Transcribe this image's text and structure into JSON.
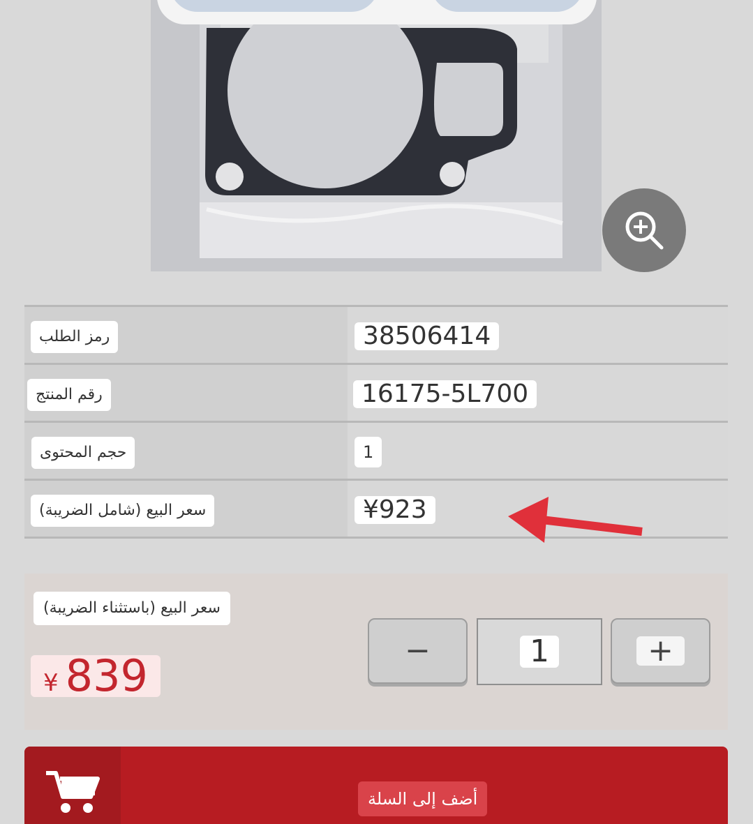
{
  "product": {
    "image_alt": "gasket",
    "zoom_icon": "zoom-in-icon"
  },
  "specs": [
    {
      "label": "رمز الطلب",
      "value": "38506414"
    },
    {
      "label": "رقم المنتج",
      "value": "16175-5L700"
    },
    {
      "label": "حجم المحتوى",
      "value": "1"
    },
    {
      "label": "سعر البيع (شامل الضريبة)",
      "value": "¥923"
    }
  ],
  "price": {
    "label": "سعر البيع (باستثناء الضريبة)",
    "currency": "¥",
    "amount": "839"
  },
  "quantity": {
    "minus_label": "−",
    "value": "1",
    "plus_label": "+"
  },
  "cart": {
    "button_label": "أضف إلى السلة",
    "icon": "cart-icon"
  },
  "colors": {
    "accent": "#b71c22",
    "price": "#c3262e",
    "arrow": "#e0303a"
  }
}
